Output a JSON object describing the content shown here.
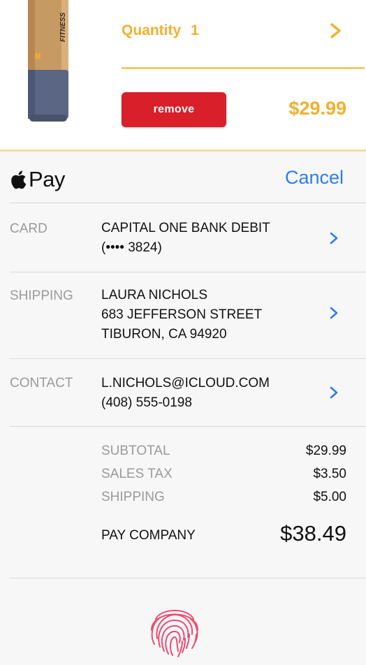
{
  "product": {
    "image_icon": "product-fitness-roller-image",
    "image_text": "FITNESS",
    "quantity_label": "Quantity",
    "quantity_value": "1",
    "remove_label": "remove",
    "price": "$29.99"
  },
  "apple_pay": {
    "logo_icon": "apple-logo-icon",
    "logo_text": "Pay",
    "cancel_label": "Cancel"
  },
  "rows": {
    "card": {
      "label": "CARD",
      "line1": "CAPITAL ONE BANK DEBIT",
      "line2": "(•••• 3824)"
    },
    "shipping": {
      "label": "SHIPPING",
      "line1": "LAURA NICHOLS",
      "line2": "683 JEFFERSON STREET",
      "line3": "TIBURON, CA 94920"
    },
    "contact": {
      "label": "CONTACT",
      "line1": "L.NICHOLS@ICLOUD.COM",
      "line2": "(408) 555-0198"
    }
  },
  "summary": {
    "subtotal_label": "SUBTOTAL",
    "subtotal_value": "$29.99",
    "tax_label": "SALES TAX",
    "tax_value": "$3.50",
    "shipping_label": "SHIPPING",
    "shipping_value": "$5.00",
    "total_label": "PAY COMPANY",
    "total_value": "$38.49"
  },
  "touch_id_icon": "fingerprint-icon",
  "colors": {
    "accent": "#f2b02e",
    "remove": "#d81f2a",
    "link": "#2d7df4",
    "fingerprint": "#ef4a6e"
  }
}
